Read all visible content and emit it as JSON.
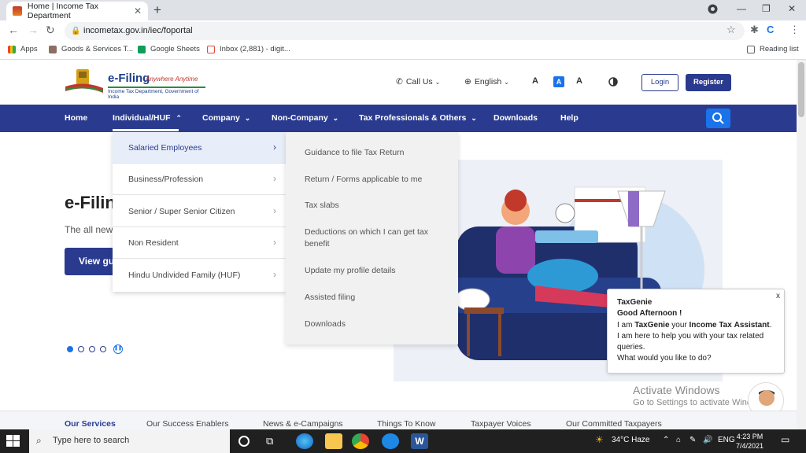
{
  "browser": {
    "tab_title": "Home | Income Tax Department",
    "tab_close": "✕",
    "new_tab": "+",
    "url": "incometax.gov.in/iec/foportal",
    "bookmarks": [
      "Apps",
      "Goods & Services T...",
      "Google Sheets",
      "Inbox (2,881) - digit...",
      "Reading list"
    ]
  },
  "site": {
    "logo_title": "e-Filing",
    "logo_tagline": "Anywhere Anytime",
    "logo_subtitle": "Income Tax Department, Government of India",
    "call_us": "Call Us",
    "language": "English",
    "font_smaller": "A",
    "font_normal": "A",
    "font_larger": "A",
    "login": "Login",
    "register": "Register"
  },
  "nav": {
    "items": [
      "Home",
      "Individual/HUF",
      "Company",
      "Non-Company",
      "Tax Professionals & Others",
      "Downloads",
      "Help"
    ]
  },
  "hero": {
    "title": "e-Filin",
    "subtitle": "The all new",
    "button": "View gu"
  },
  "menu": {
    "left": [
      "Salaried Employees",
      "Business/Profession",
      "Senior / Super Senior Citizen",
      "Non Resident",
      "Hindu Undivided Family (HUF)"
    ],
    "right": [
      "Guidance to file Tax Return",
      "Return / Forms applicable to me",
      "Tax slabs",
      "Deductions on which I can get tax benefit",
      "Update my profile details",
      "Assisted filing",
      "Downloads"
    ]
  },
  "genie": {
    "close": "x",
    "name": "TaxGenie",
    "greeting": "Good Afternoon !",
    "line_pre": "I am ",
    "line_name": "TaxGenie",
    "line_mid": " your ",
    "line_role1": "Income Tax",
    "line_role2": "Assistant",
    "line_post": ". I am here to help you with your tax related queries.",
    "question": "What would you like to do?"
  },
  "bottom_tabs": [
    "Our Services",
    "Our Success Enablers",
    "News & e-Campaigns",
    "Things To Know",
    "Taxpayer Voices",
    "Our Committed Taxpayers"
  ],
  "watermark": {
    "line1": "Activate Windows",
    "line2": "Go to Settings to activate Windows."
  },
  "taskbar": {
    "search_placeholder": "Type here to search",
    "weather": "34°C  Haze",
    "lang": "ENG",
    "time": "4:23 PM",
    "date": "7/4/2021"
  },
  "colors": {
    "nav_blue": "#2a3b8f",
    "accent_blue": "#1a73e8"
  }
}
